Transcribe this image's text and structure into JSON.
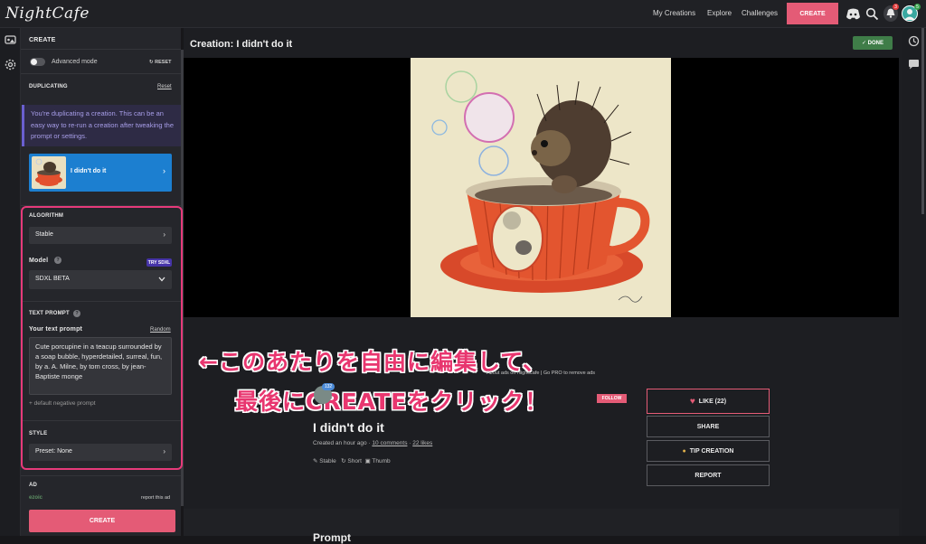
{
  "topbar": {
    "logo": "NightCafe",
    "nav": [
      "My Creations",
      "Explore",
      "Challenges"
    ],
    "create_label": "CREATE",
    "notification_count": "3",
    "avatar_badge": "5",
    "icons": [
      "discord-icon",
      "search-icon",
      "bell-icon",
      "avatar"
    ]
  },
  "left_panel": {
    "header": "CREATE",
    "advanced_mode": "Advanced mode",
    "reset_label": "RESET",
    "duplicating_title": "DUPLICATING",
    "duplicating_reset": "Reset",
    "notice": "You're duplicating a creation. This can be an easy way to re-run a creation after tweaking the prompt or settings.",
    "dup_card_title": "I didn't do it",
    "algorithm_title": "ALGORITHM",
    "algorithm_value": "Stable",
    "model_label": "Model",
    "try_sdxl": "TRY SDXL",
    "model_value": "SDXL BETA",
    "text_prompt_title": "TEXT PROMPT",
    "your_prompt_label": "Your text prompt",
    "random_label": "Random",
    "prompt_text": "Cute porcupine in a teacup surrounded by a soap bubble, hyperdetailed, surreal, fun, by a. A. Milne, by tom cross, by jean-Baptiste monge",
    "negative_prompt": "+ default negative prompt",
    "style_title": "STYLE",
    "style_value": "Preset: None",
    "ad_title": "AD",
    "ezoic": "ezoic",
    "report_ad": "report this ad",
    "create_label": "CREATE"
  },
  "main": {
    "title": "Creation: I didn't do it",
    "done_label": "DONE",
    "annotation_line1": "←このあたりを自由に編集して、",
    "annotation_line2": "最後にCREATEをクリック！",
    "ads_text": "About ads on NightCafe | Go PRO to remove ads",
    "follow_label": "FOLLOW",
    "creator_badge": "132",
    "creation_title": "I didn't do it",
    "created": "Created an hour ago",
    "comments": "10 comments",
    "likes_link": "22 likes",
    "tags": [
      "Stable",
      "Short",
      "Thumb"
    ],
    "like_button": "LIKE (22)",
    "share_button": "SHARE",
    "tip_button": "TIP CREATION",
    "report_button": "REPORT",
    "partial_heading": "Prompt"
  },
  "colors": {
    "accent": "#e45b76",
    "blue_card": "#1c7fd0",
    "highlight": "#e63a7a",
    "done_green": "#3f7d48",
    "notice_purple": "#a79de8"
  }
}
